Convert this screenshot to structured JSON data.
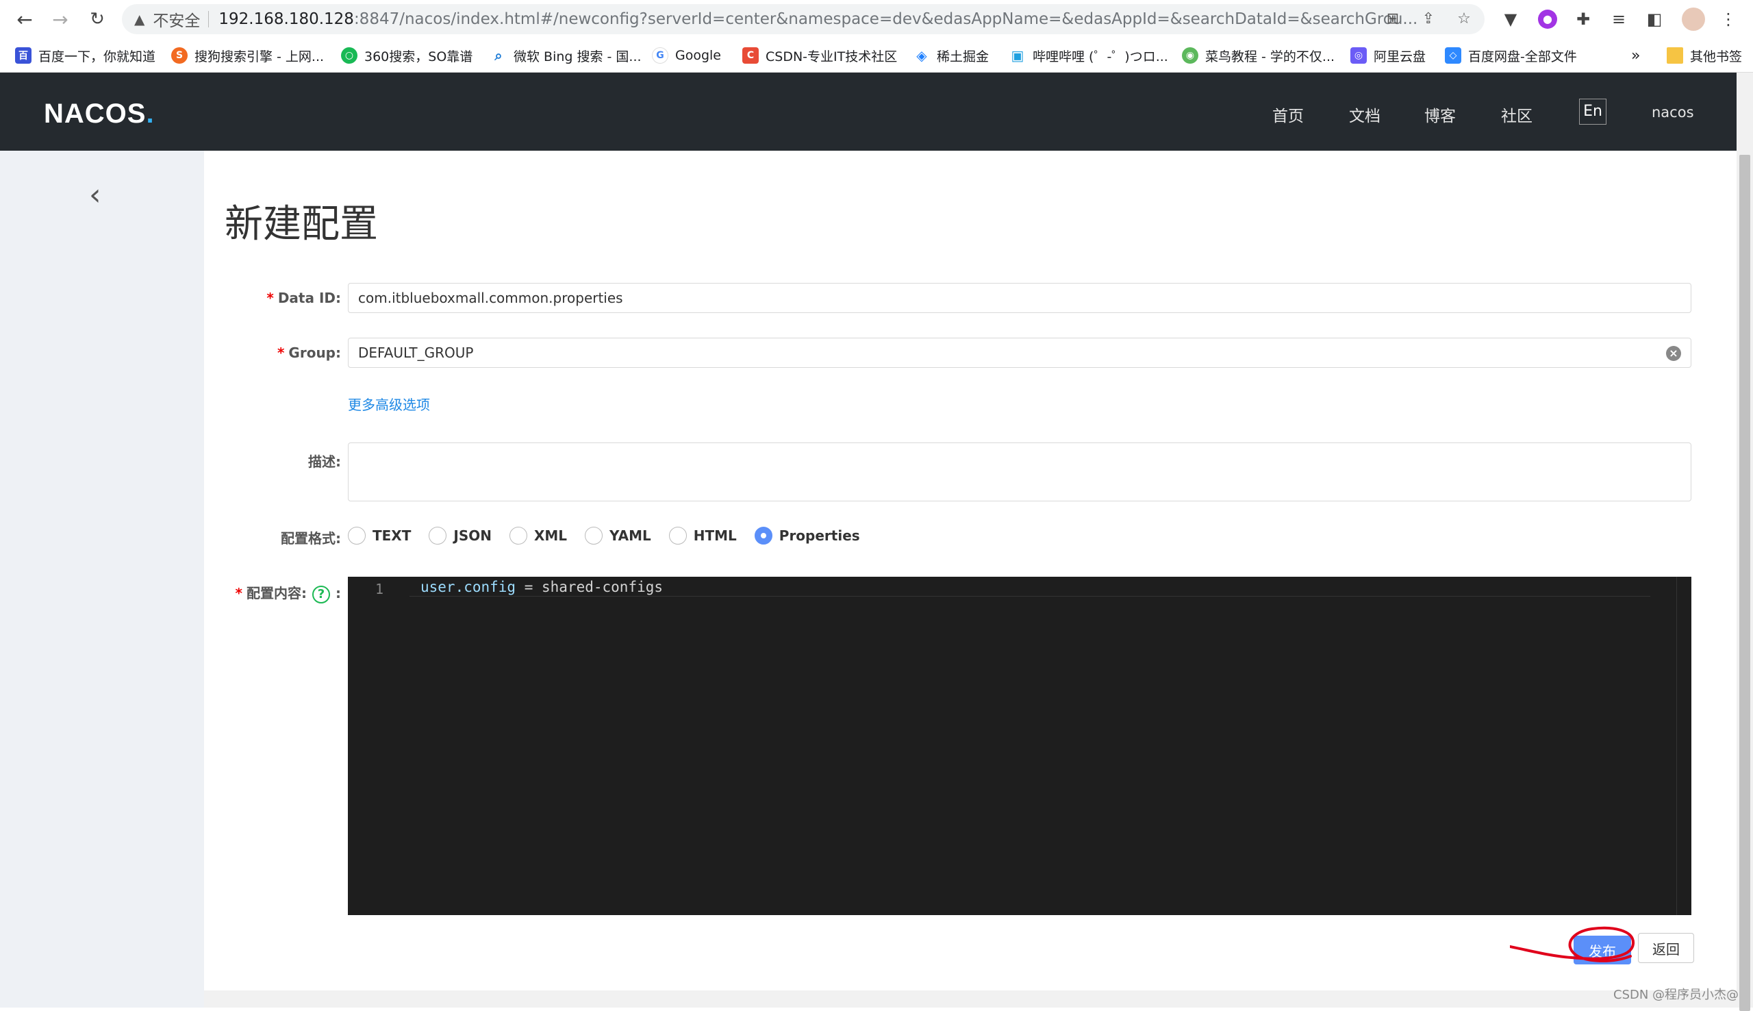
{
  "browser": {
    "insecure_label": "不安全",
    "url_host": "192.168.180.128",
    "url_path": ":8847/nacos/index.html#/newconfig?serverId=center&namespace=dev&edasAppName=&edasAppId=&searchDataId=&searchGrou...",
    "bookmarks": [
      {
        "label": "百度一下，你就知道",
        "color": "#3a53d8",
        "glyph": "百"
      },
      {
        "label": "搜狗搜索引擎 - 上网...",
        "color": "#f26a21",
        "glyph": "S"
      },
      {
        "label": "360搜索，SO靠谱",
        "color": "#19b955",
        "glyph": "○"
      },
      {
        "label": "微软 Bing 搜索 - 国...",
        "color": "#1c7bd6",
        "glyph": "⌕"
      },
      {
        "label": "Google",
        "color": "#4285f4",
        "glyph": "G"
      },
      {
        "label": "CSDN-专业IT技术社区",
        "color": "#e84b36",
        "glyph": "C"
      },
      {
        "label": "稀土掘金",
        "color": "#1e80ff",
        "glyph": "◈"
      },
      {
        "label": "哔哩哔哩 (゜-゜)つロ...",
        "color": "#20a0e0",
        "glyph": "▣"
      },
      {
        "label": "菜鸟教程 - 学的不仅...",
        "color": "#5cb85c",
        "glyph": "◉"
      },
      {
        "label": "阿里云盘",
        "color": "#6b5cf6",
        "glyph": "◎"
      },
      {
        "label": "百度网盘-全部文件",
        "color": "#2e89ff",
        "glyph": "◇"
      }
    ],
    "more_bookmarks": "»",
    "other_bookmarks": "其他书签"
  },
  "header": {
    "logo_text": "NACOS",
    "logo_dot": ".",
    "nav": [
      "首页",
      "文档",
      "博客",
      "社区"
    ],
    "lang": "En",
    "user": "nacos"
  },
  "page": {
    "title": "新建配置",
    "data_id_label": "Data ID:",
    "data_id_value": "com.itblueboxmall.common.properties",
    "group_label": "Group:",
    "group_value": "DEFAULT_GROUP",
    "advanced_link": "更多高级选项",
    "desc_label": "描述:",
    "desc_value": "",
    "format_label": "配置格式:",
    "formats": [
      "TEXT",
      "JSON",
      "XML",
      "YAML",
      "HTML",
      "Properties"
    ],
    "selected_format": "Properties",
    "content_label": "配置内容:",
    "content_help": "?",
    "content_colon": ":",
    "editor_line_number": "1",
    "code_key": "user.config",
    "code_rest": " = shared-configs",
    "publish_button": "发布",
    "back_button": "返回"
  },
  "watermark": "CSDN @程序员小杰@",
  "colors": {
    "header_bg": "#252a2f",
    "primary": "#5b8ff9",
    "link": "#1e88e5",
    "required": "#e00000",
    "annotation": "#e0001b"
  }
}
